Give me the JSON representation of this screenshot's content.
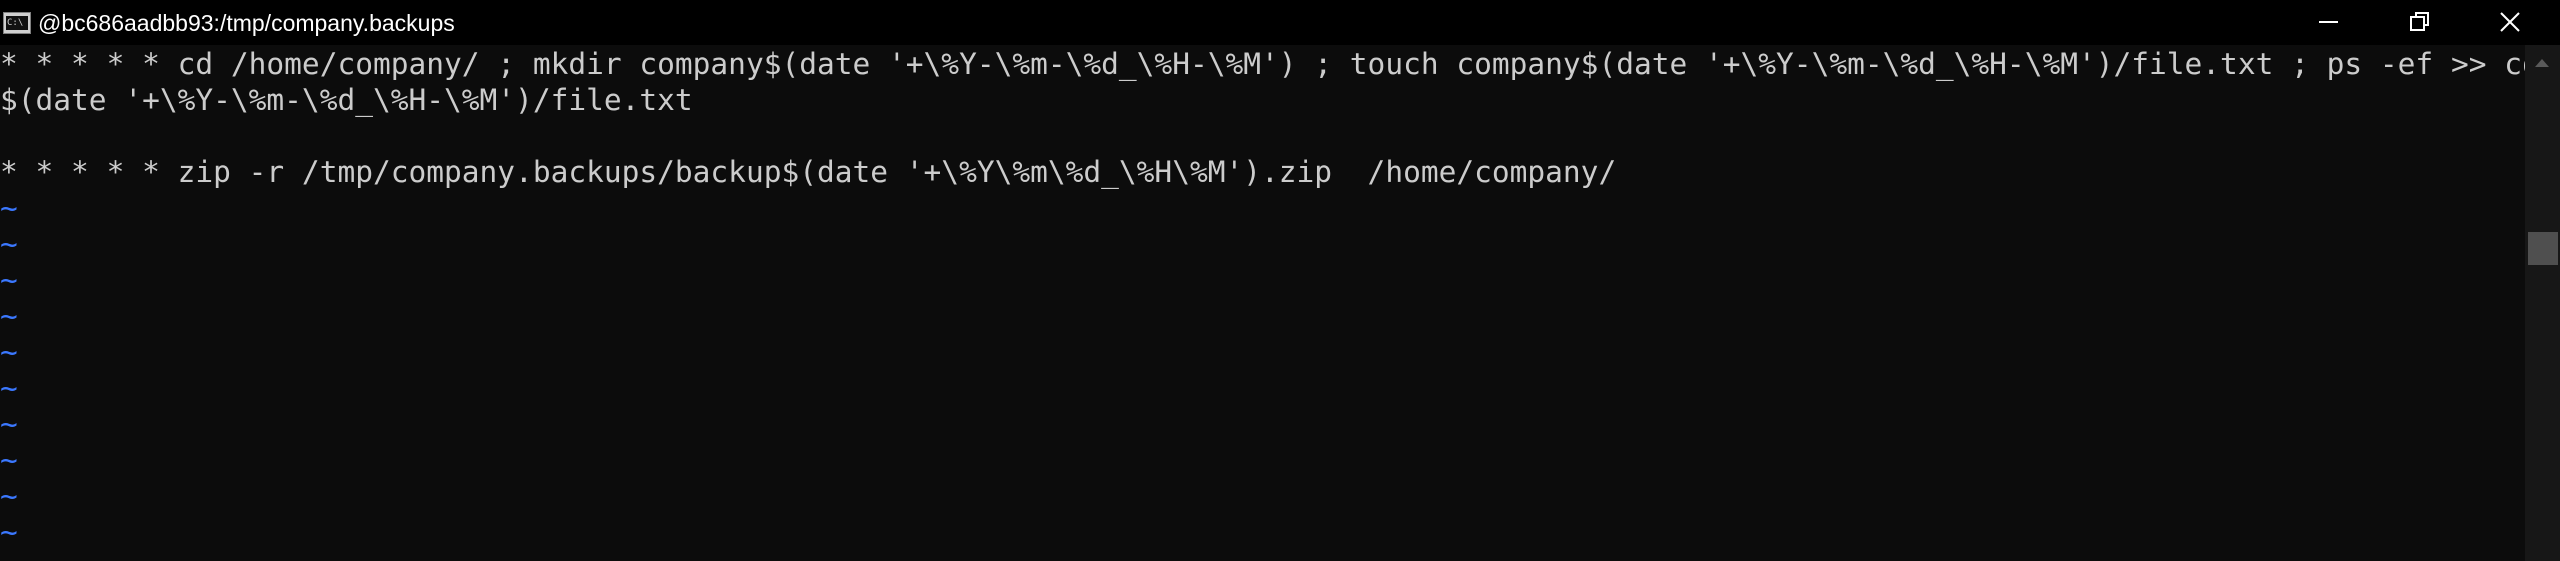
{
  "window": {
    "title": "@bc686aadbb93:/tmp/company.backups",
    "icon": "console-window-icon",
    "icon_prompt": "C:\\",
    "controls": {
      "minimize": "minimize-icon",
      "restore": "restore-icon",
      "close": "close-icon"
    }
  },
  "terminal": {
    "lines": [
      "* * * * * cd /home/company/ ; mkdir company$(date '+\\%Y-\\%m-\\%d_\\%H-\\%M') ; touch company$(date '+\\%Y-\\%m-\\%d_\\%H-\\%M')/file.txt ; ps -ef >> company",
      "$(date '+\\%Y-\\%m-\\%d_\\%H-\\%M')/file.txt",
      "",
      "* * * * * zip -r /tmp/company.backups/backup$(date '+\\%Y\\%m\\%d_\\%H\\%M').zip  /home/company/"
    ],
    "empty_marker": "~",
    "empty_line_count": 10
  },
  "colors": {
    "background": "#0c0c0c",
    "titlebar": "#000000",
    "text": "#cccccc",
    "tilde": "#3b78ff"
  }
}
